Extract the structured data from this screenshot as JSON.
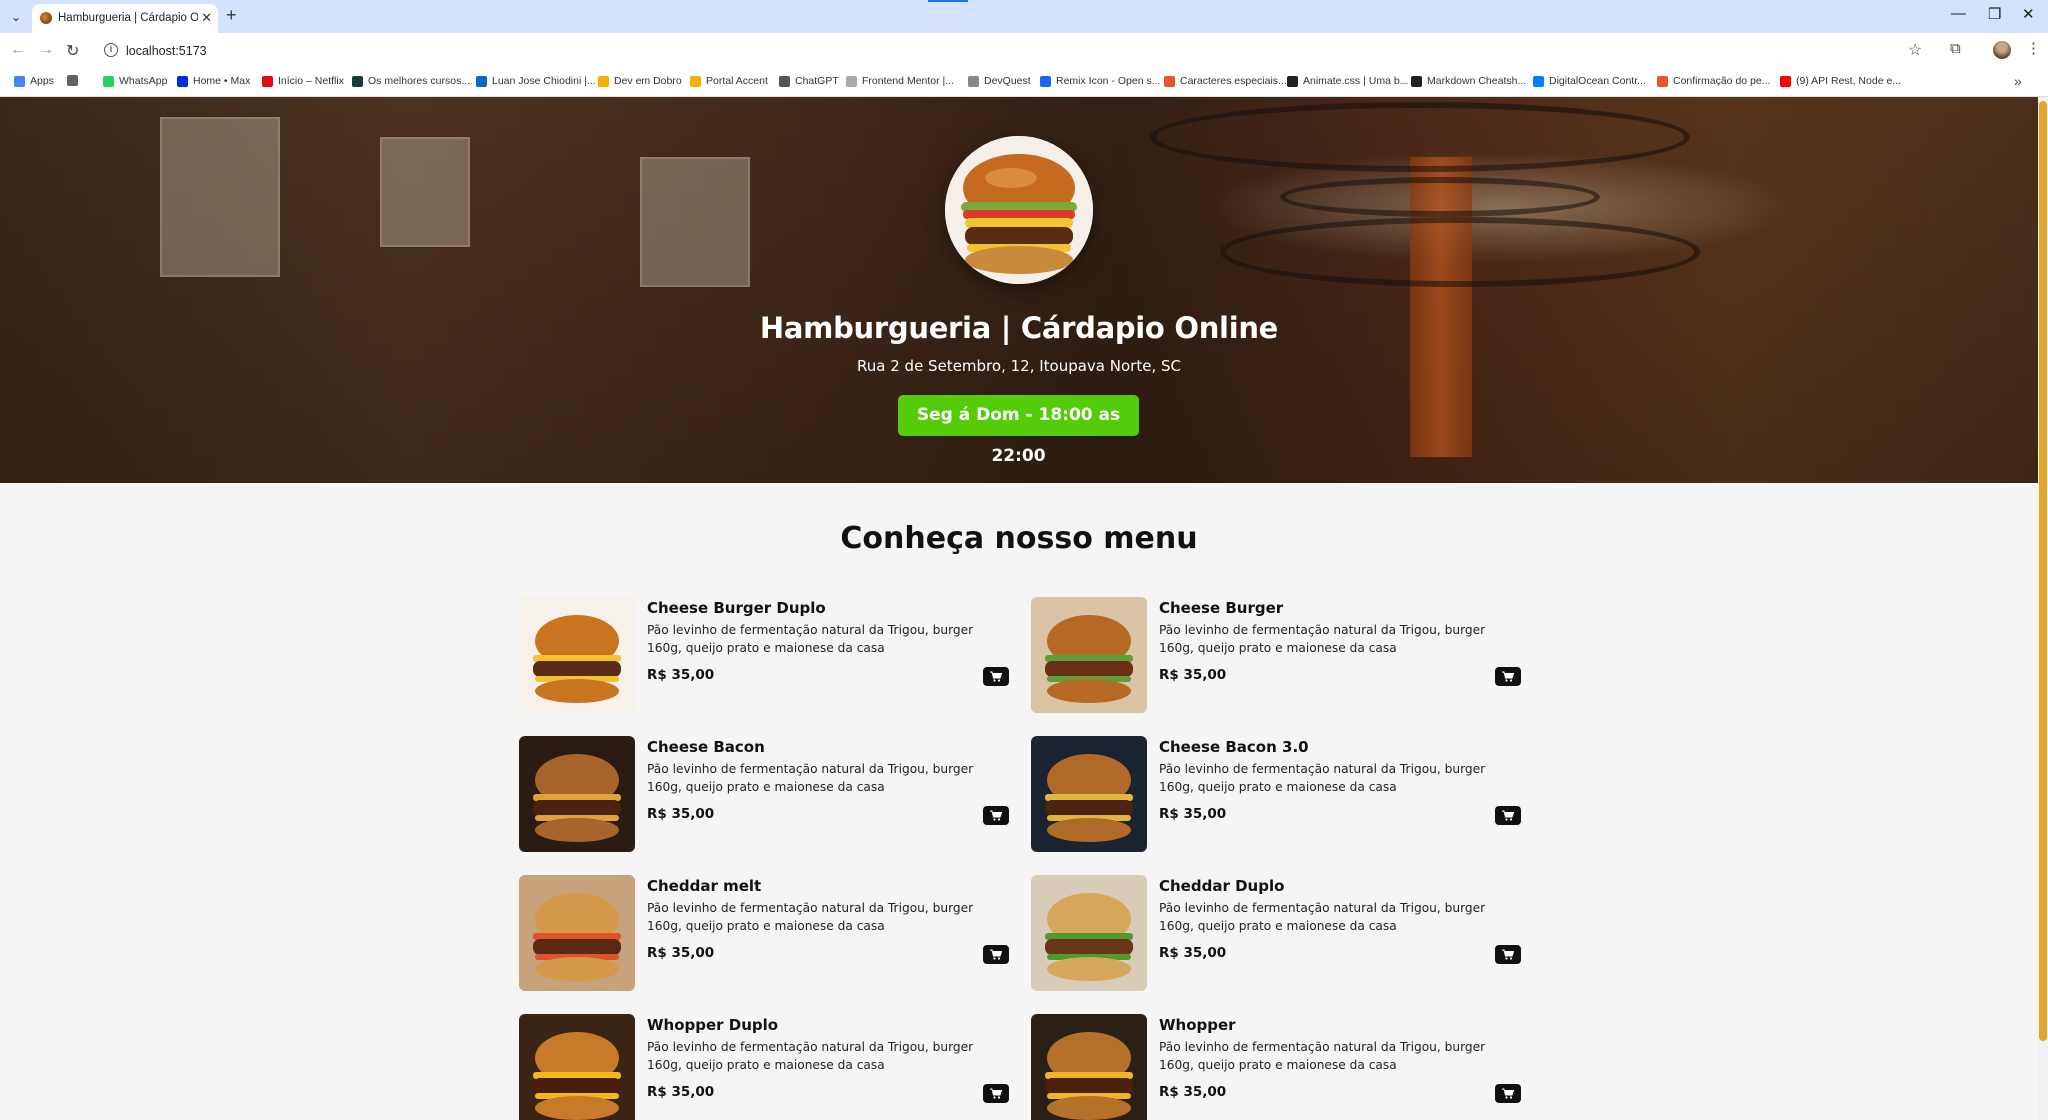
{
  "browser": {
    "tab_title": "Hamburgueria | Cárdapio Online",
    "url": "localhost:5173",
    "bookmarks": [
      {
        "label": "Apps",
        "color": "#4285f4"
      },
      {
        "label": "",
        "color": "#5f6368"
      },
      {
        "label": "WhatsApp",
        "color": "#25d366"
      },
      {
        "label": "Home • Max",
        "color": "#002be7"
      },
      {
        "label": "Início – Netflix",
        "color": "#e50914"
      },
      {
        "label": "Os melhores cursos...",
        "color": "#1a3a3a"
      },
      {
        "label": "Luan Jose Chiodini |...",
        "color": "#0a66c2"
      },
      {
        "label": "Dev em Dobro",
        "color": "#f2b100"
      },
      {
        "label": "Portal Accent",
        "color": "#f2b100"
      },
      {
        "label": "ChatGPT",
        "color": "#555555"
      },
      {
        "label": "Frontend Mentor |...",
        "color": "#aaaaaa"
      },
      {
        "label": "DevQuest",
        "color": "#888888"
      },
      {
        "label": "Remix Icon - Open s...",
        "color": "#1e66f5"
      },
      {
        "label": "Caracteres especiais...",
        "color": "#e8542b"
      },
      {
        "label": "Animate.css | Uma b...",
        "color": "#222222"
      },
      {
        "label": "Markdown Cheatsh...",
        "color": "#222222"
      },
      {
        "label": "DigitalOcean Contr...",
        "color": "#0080ff"
      },
      {
        "label": "Confirmação do pe...",
        "color": "#e8542b"
      },
      {
        "label": "(9) API Rest, Node e...",
        "color": "#ff0000"
      }
    ]
  },
  "hero": {
    "title": "Hamburgueria | Cárdapio Online",
    "address": "Rua 2 de Setembro, 12, Itoupava Norte, SC",
    "hours": "Seg á Dom - 18:00 as 22:00",
    "hours_color": "#54cc0a"
  },
  "menu": {
    "title": "Conheça nosso menu",
    "items": [
      {
        "name": "Cheese Burger Duplo",
        "desc": "Pão levinho de fermentação natural da Trigou, burger 160g, queijo prato e maionese da casa",
        "price": "R$ 35,00"
      },
      {
        "name": "Cheese Burger",
        "desc": "Pão levinho de fermentação natural da Trigou, burger 160g, queijo prato e maionese da casa",
        "price": "R$ 35,00"
      },
      {
        "name": "Cheese Bacon",
        "desc": "Pão levinho de fermentação natural da Trigou, burger 160g, queijo prato e maionese da casa",
        "price": "R$ 35,00"
      },
      {
        "name": "Cheese Bacon 3.0",
        "desc": "Pão levinho de fermentação natural da Trigou, burger 160g, queijo prato e maionese da casa",
        "price": "R$ 35,00"
      },
      {
        "name": "Cheddar melt",
        "desc": "Pão levinho de fermentação natural da Trigou, burger 160g, queijo prato e maionese da casa",
        "price": "R$ 35,00"
      },
      {
        "name": "Cheddar Duplo",
        "desc": "Pão levinho de fermentação natural da Trigou, burger 160g, queijo prato e maionese da casa",
        "price": "R$ 35,00"
      },
      {
        "name": "Whopper Duplo",
        "desc": "Pão levinho de fermentação natural da Trigou, burger 160g, queijo prato e maionese da casa",
        "price": "R$ 35,00"
      },
      {
        "name": "Whopper",
        "desc": "Pão levinho de fermentação natural da Trigou, burger 160g, queijo prato e maionese da casa",
        "price": "R$ 35,00"
      }
    ]
  }
}
